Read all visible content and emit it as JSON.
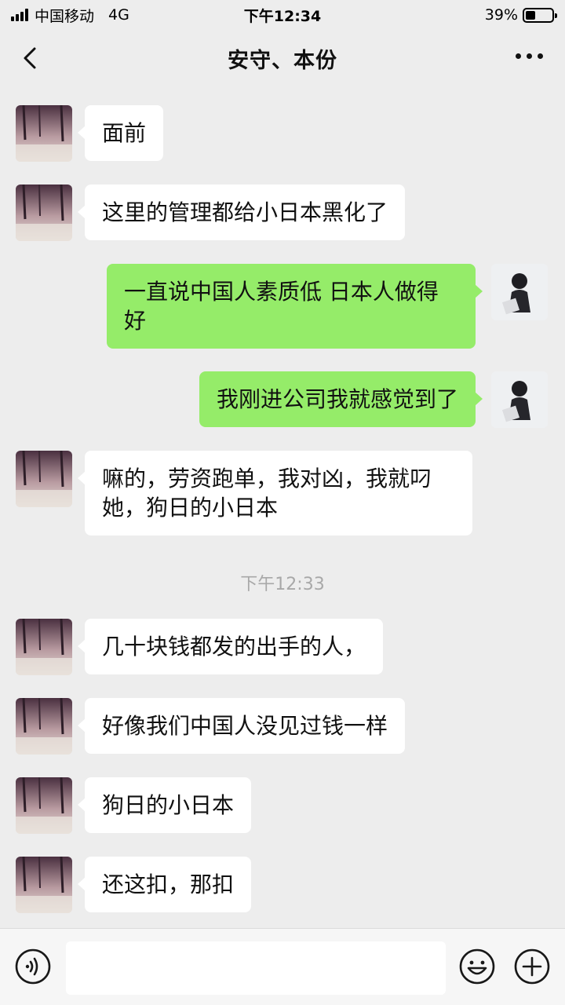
{
  "status_bar": {
    "carrier": "中国移动",
    "network": "4G",
    "time": "下午12:34",
    "battery": "39%",
    "battery_level": 0.39
  },
  "header": {
    "back_icon": "chevron-left-icon",
    "title": "安守、本份",
    "more_icon": "more-dots-icon"
  },
  "messages": [
    {
      "side": "left",
      "text": "面前"
    },
    {
      "side": "left",
      "text": "这里的管理都给小日本黑化了"
    },
    {
      "side": "right",
      "text": "一直说中国人素质低 日本人做得好"
    },
    {
      "side": "right",
      "text": "我刚进公司我就感觉到了"
    },
    {
      "side": "left",
      "text": "嘛的，劳资跑单，我对凶，我就叼她，狗日的小日本"
    },
    {
      "side": "left",
      "text": "几十块钱都发的出手的人，"
    },
    {
      "side": "left",
      "text": "好像我们中国人没见过钱一样"
    },
    {
      "side": "left",
      "text": "狗日的小日本"
    },
    {
      "side": "left",
      "text": "还这扣，那扣"
    }
  ],
  "timestamp": "下午12:33",
  "input_bar": {
    "voice_icon": "voice-icon",
    "text_value": "",
    "emoji_icon": "emoji-icon",
    "plus_icon": "plus-icon"
  },
  "colors": {
    "background": "#ededed",
    "bubble_self": "#95ec69",
    "bubble_other": "#ffffff"
  }
}
